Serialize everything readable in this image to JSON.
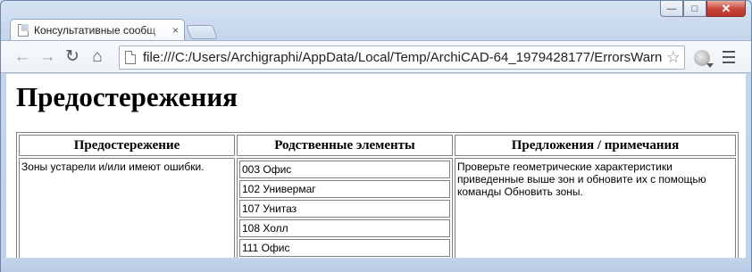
{
  "browser": {
    "tab_title": "Консультативные сообщ",
    "tab_close": "×",
    "url": "file:///C:/Users/Archigraphi/AppData/Local/Temp/ArchiCAD-64_1979428177/ErrorsWarn",
    "nav": {
      "back_glyph": "←",
      "forward_glyph": "→",
      "reload_glyph": "↻",
      "home_glyph": "⌂",
      "star_glyph": "☆"
    },
    "window_controls": {
      "minimize": "—",
      "maximize": "□",
      "close": "✕"
    }
  },
  "page": {
    "title": "Предостережения",
    "table": {
      "headers": [
        "Предостережение",
        "Родственные элементы",
        "Предложения / примечания"
      ],
      "warning": "Зоны устарели и/или имеют ошибки.",
      "elements": [
        "003 Офис",
        "102 Универмаг",
        "107 Унитаз",
        "108 Холл",
        "111 Офис"
      ],
      "suggestion": "Проверьте геометрические характеристики приведенные выше зон и обновите их с помощью команды Обновить зоны."
    }
  }
}
